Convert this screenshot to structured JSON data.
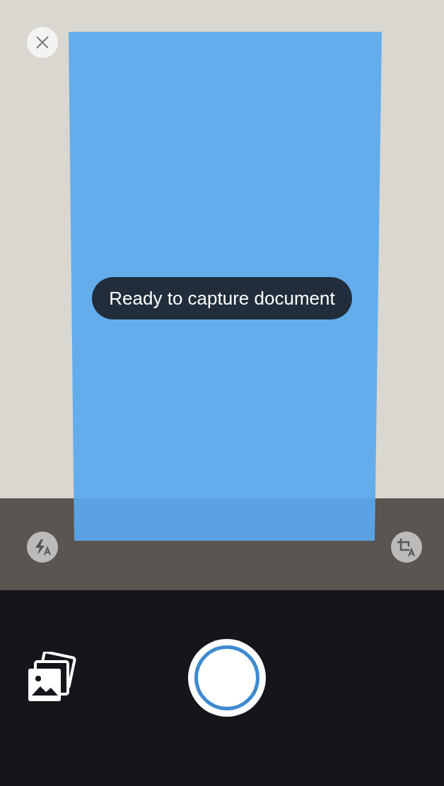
{
  "toast": {
    "text": "Ready to capture document"
  }
}
